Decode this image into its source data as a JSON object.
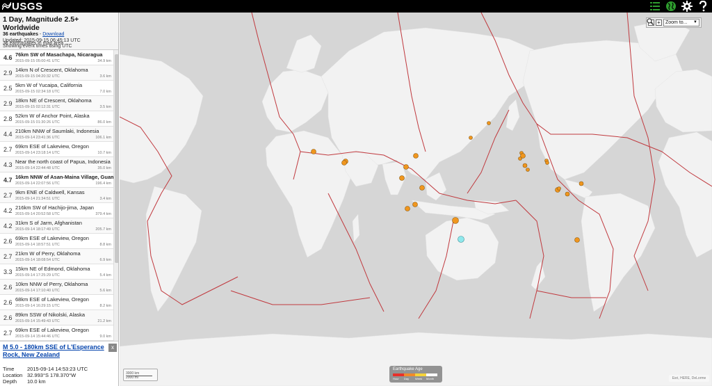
{
  "header": {
    "logo_text": "USGS",
    "icons": [
      "list-icon",
      "globe-icon",
      "gear-icon",
      "help-icon"
    ],
    "accent": "#2e9c2e"
  },
  "summary": {
    "title": "1 Day, Magnitude 2.5+ Worldwide",
    "count_text": "36 earthquakes",
    "dash": " - ",
    "download_label": "Download",
    "updated": "Updated: 2015-09-15 06:45:13 UTC",
    "time_note": "Showing event times using UTC",
    "in_map_area": "36 earthquakes in map area"
  },
  "earthquakes": [
    {
      "mag": "4.6",
      "place": "76km SW of Masachapa, Nicaragua",
      "time": "2015-09-15 05:00:41 UTC",
      "depth": "34.9 km",
      "bold": true
    },
    {
      "mag": "2.9",
      "place": "14km N of Crescent, Oklahoma",
      "time": "2015-09-15 04:20:32 UTC",
      "depth": "3.6 km",
      "bold": false
    },
    {
      "mag": "2.5",
      "place": "5km W of Yucaipa, California",
      "time": "2015-09-15 02:34:18 UTC",
      "depth": "7.0 km",
      "bold": false
    },
    {
      "mag": "2.9",
      "place": "18km NE of Crescent, Oklahoma",
      "time": "2015-09-15 02:12:31 UTC",
      "depth": "3.5 km",
      "bold": false
    },
    {
      "mag": "2.8",
      "place": "52km W of Anchor Point, Alaska",
      "time": "2015-09-15 01:30:26 UTC",
      "depth": "86.0 km",
      "bold": false
    },
    {
      "mag": "4.4",
      "place": "210km NNW of Saumlaki, Indonesia",
      "time": "2015-09-14 23:41:36 UTC",
      "depth": "106.1 km",
      "bold": false
    },
    {
      "mag": "2.7",
      "place": "69km ESE of Lakeview, Oregon",
      "time": "2015-09-14 23:18:14 UTC",
      "depth": "10.7 km",
      "bold": false
    },
    {
      "mag": "4.3",
      "place": "Near the north coast of Papua, Indonesia",
      "time": "2015-09-14 22:44:48 UTC",
      "depth": "35.0 km",
      "bold": false
    },
    {
      "mag": "4.7",
      "place": "16km NNW of Asan-Maina Village, Guam",
      "time": "2015-09-14 22:07:56 UTC",
      "depth": "196.4 km",
      "bold": true
    },
    {
      "mag": "2.7",
      "place": "9km ENE of Caldwell, Kansas",
      "time": "2015-09-14 21:34:51 UTC",
      "depth": "3.4 km",
      "bold": false
    },
    {
      "mag": "4.2",
      "place": "216km SW of Hachijo-jima, Japan",
      "time": "2015-09-14 20:52:58 UTC",
      "depth": "379.4 km",
      "bold": false
    },
    {
      "mag": "4.2",
      "place": "31km S of Jarm, Afghanistan",
      "time": "2015-09-14 18:17:49 UTC",
      "depth": "205.7 km",
      "bold": false
    },
    {
      "mag": "2.6",
      "place": "69km ESE of Lakeview, Oregon",
      "time": "2015-09-14 18:57:51 UTC",
      "depth": "8.8 km",
      "bold": false
    },
    {
      "mag": "2.7",
      "place": "21km W of Perry, Oklahoma",
      "time": "2015-09-14 18:08:54 UTC",
      "depth": "6.9 km",
      "bold": false
    },
    {
      "mag": "3.3",
      "place": "15km NE of Edmond, Oklahoma",
      "time": "2015-09-14 17:25:29 UTC",
      "depth": "5.4 km",
      "bold": false
    },
    {
      "mag": "2.6",
      "place": "10km NNW of Perry, Oklahoma",
      "time": "2015-09-14 17:10:40 UTC",
      "depth": "5.6 km",
      "bold": false
    },
    {
      "mag": "2.6",
      "place": "68km ESE of Lakeview, Oregon",
      "time": "2015-09-14 16:29:15 UTC",
      "depth": "8.2 km",
      "bold": false
    },
    {
      "mag": "2.6",
      "place": "89km SSW of Nikolski, Alaska",
      "time": "2015-09-14 15:49:43 UTC",
      "depth": "21.2 km",
      "bold": false
    },
    {
      "mag": "2.7",
      "place": "69km ESE of Lakeview, Oregon",
      "time": "2015-09-14 15:44:46 UTC",
      "depth": "9.0 km",
      "bold": false
    }
  ],
  "detail": {
    "title": "M 5.0 - 180km SSE of L'Esperance Rock, New Zealand",
    "close_label": "x",
    "time_label": "Time",
    "time_value": "2015-09-14 14:53:23 UTC",
    "location_label": "Location",
    "location_value": "32.993°S 178.370°W",
    "depth_label": "Depth",
    "depth_value": "10.0 km"
  },
  "map": {
    "zoom_in": "+",
    "zoom_out": "−",
    "zoom_select": "Zoom to...",
    "scale_top": "3000 km",
    "scale_bottom": "2000 mi",
    "legend_title": "Earthquake Age",
    "legend_ticks": [
      "Hour",
      "Day",
      "Week",
      "Month"
    ],
    "legend_colors": [
      "#e8302a",
      "#f08a2a",
      "#f5d33a",
      "#ffffff"
    ],
    "attribution": "Esri, HERE, DeLorme",
    "quake_color": "#f0961e",
    "selected_color": "#8fe8ec",
    "plate_color": "#c0393e",
    "land_color": "#f2f2f2",
    "water_color": "#d6d6d6"
  }
}
